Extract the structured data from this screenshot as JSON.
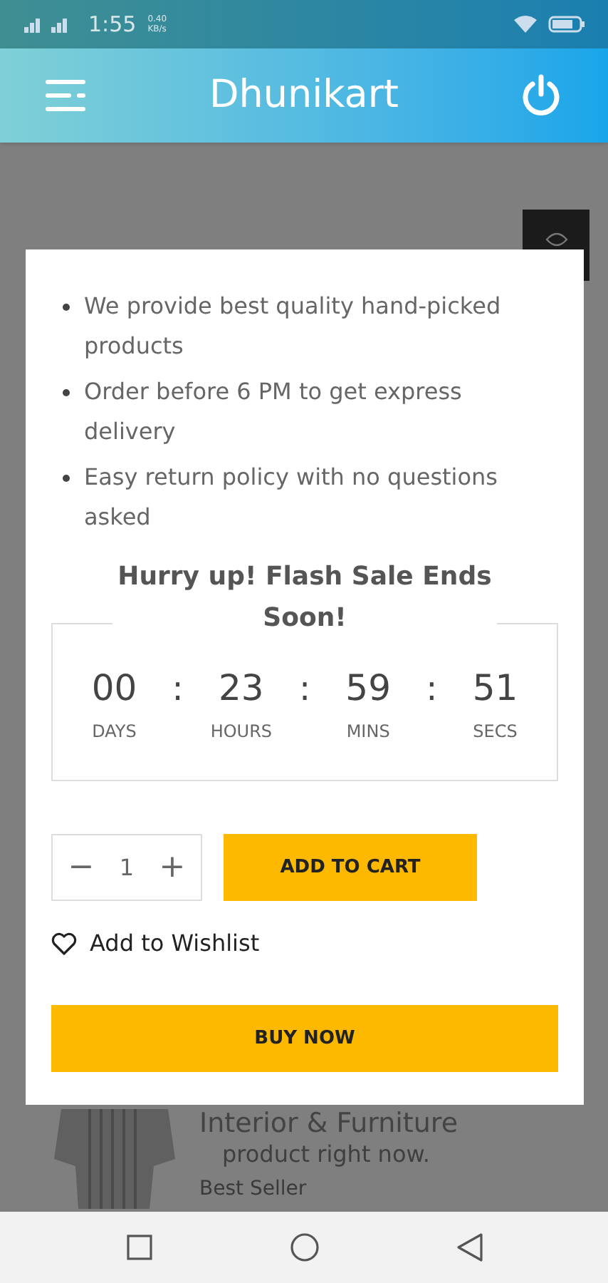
{
  "status_bar": {
    "time": "1:55",
    "speed": "0.40 KB/s"
  },
  "header": {
    "title": "Dhunikart"
  },
  "background": {
    "heading": "Interior & Furniture",
    "viewers_text": "product right now.",
    "badge": "Best Seller"
  },
  "modal": {
    "features": [
      "We provide best quality hand-picked products",
      "Order before 6 PM to get express delivery",
      "Easy return policy with no questions asked"
    ],
    "countdown": {
      "title": "Hurry up! Flash Sale Ends Soon!",
      "units": [
        {
          "value": "00",
          "label": "DAYS"
        },
        {
          "value": "23",
          "label": "HOURS"
        },
        {
          "value": "59",
          "label": "MINS"
        },
        {
          "value": "51",
          "label": "SECS"
        }
      ],
      "separator": ":"
    },
    "quantity": {
      "minus": "−",
      "value": "1",
      "plus": "+"
    },
    "add_to_cart": "ADD TO CART",
    "wishlist": "Add to Wishlist",
    "buy_now": "BUY NOW"
  }
}
